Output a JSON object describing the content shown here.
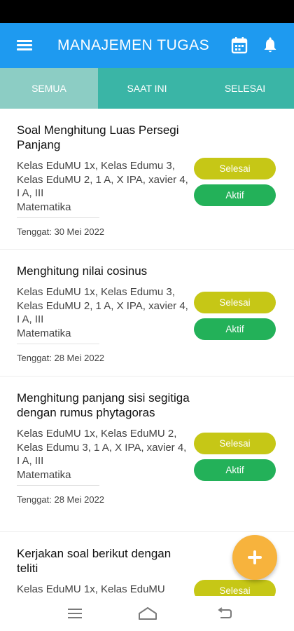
{
  "header": {
    "title": "MANAJEMEN TUGAS",
    "menu_icon": "hamburger-menu-icon",
    "calendar_icon": "calendar-icon",
    "bell_icon": "bell-icon",
    "color": "#1e9af0"
  },
  "tabs": [
    {
      "label": "SEMUA",
      "active": true
    },
    {
      "label": "SAAT INI",
      "active": false
    },
    {
      "label": "SELESAI",
      "active": false
    }
  ],
  "tasks": [
    {
      "title": "Soal Menghitung Luas Persegi Panjang",
      "classes": "Kelas EduMU 1x, Kelas Edumu 3, Kelas EduMU 2, 1 A, X IPA, xavier 4, I A, III",
      "subject": "Matematika",
      "due": "Tenggat: 30 Mei 2022",
      "done_label": "Selesai",
      "active_label": "Aktif"
    },
    {
      "title": "Menghitung nilai cosinus",
      "classes": "Kelas EduMU 1x, Kelas Edumu 3, Kelas EduMU 2, 1 A, X IPA, xavier 4, I A, III",
      "subject": "Matematika",
      "due": "Tenggat: 28 Mei 2022",
      "done_label": "Selesai",
      "active_label": "Aktif"
    },
    {
      "title": "Menghitung panjang sisi segitiga dengan rumus phytagoras",
      "classes": "Kelas EduMU 1x, Kelas EduMU 2, Kelas Edumu 3, 1 A, X IPA, xavier 4, I A, III",
      "subject": "Matematika",
      "due": "Tenggat: 28 Mei 2022",
      "done_label": "Selesai",
      "active_label": "Aktif"
    },
    {
      "title": "Kerjakan soal berikut dengan teliti",
      "classes": "Kelas EduMU 1x, Kelas EduMU",
      "done_label": "Selesai"
    }
  ],
  "fab_icon": "plus-icon",
  "nav": {
    "recents_icon": "recents-icon",
    "home_icon": "home-icon",
    "back_icon": "back-icon"
  },
  "colors": {
    "tab_bar": "#3ab5a6",
    "tab_active": "#8ccdc4",
    "button_done": "#c6c716",
    "button_active": "#23b159",
    "fab": "#f7b33d"
  }
}
